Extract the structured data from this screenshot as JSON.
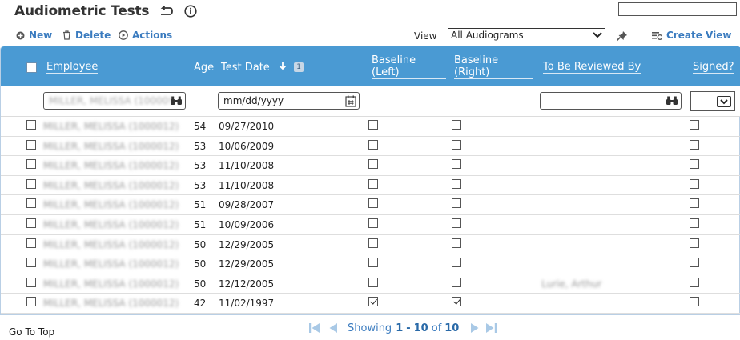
{
  "page": {
    "title": "Audiometric Tests",
    "icons": [
      "back-arrow-icon",
      "info-icon"
    ]
  },
  "toolbar": {
    "new_label": "New",
    "delete_label": "Delete",
    "actions_label": "Actions",
    "view_label": "View",
    "view_selected": "All Audiograms",
    "create_view_label": "Create View"
  },
  "columns": {
    "employee": "Employee",
    "age": "Age",
    "test_date": "Test Date",
    "sort_badge": "1",
    "baseline_left_1": "Baseline",
    "baseline_left_2": "(Left)",
    "baseline_right_1": "Baseline",
    "baseline_right_2": "(Right)",
    "reviewer": "To Be Reviewed By",
    "signed": "Signed?"
  },
  "filters": {
    "employee_value": "MILLER, MELISSA (10000!",
    "date_placeholder": "mm/dd/yyyy",
    "reviewer_value": ""
  },
  "rows": [
    {
      "employee": "MILLER, MELISSA (1000012)",
      "age": "54",
      "date": "09/27/2010",
      "bl": false,
      "br": false,
      "reviewer": "",
      "signed": false
    },
    {
      "employee": "MILLER, MELISSA (1000012)",
      "age": "53",
      "date": "10/06/2009",
      "bl": false,
      "br": false,
      "reviewer": "",
      "signed": false
    },
    {
      "employee": "MILLER, MELISSA (1000012)",
      "age": "53",
      "date": "11/10/2008",
      "bl": false,
      "br": false,
      "reviewer": "",
      "signed": false
    },
    {
      "employee": "MILLER, MELISSA (1000012)",
      "age": "53",
      "date": "11/10/2008",
      "bl": false,
      "br": false,
      "reviewer": "",
      "signed": false
    },
    {
      "employee": "MILLER, MELISSA (1000012)",
      "age": "51",
      "date": "09/28/2007",
      "bl": false,
      "br": false,
      "reviewer": "",
      "signed": false
    },
    {
      "employee": "MILLER, MELISSA (1000012)",
      "age": "51",
      "date": "10/09/2006",
      "bl": false,
      "br": false,
      "reviewer": "",
      "signed": false
    },
    {
      "employee": "MILLER, MELISSA (1000012)",
      "age": "50",
      "date": "12/29/2005",
      "bl": false,
      "br": false,
      "reviewer": "",
      "signed": false
    },
    {
      "employee": "MILLER, MELISSA (1000012)",
      "age": "50",
      "date": "12/29/2005",
      "bl": false,
      "br": false,
      "reviewer": "",
      "signed": false
    },
    {
      "employee": "MILLER, MELISSA (1000012)",
      "age": "50",
      "date": "12/12/2005",
      "bl": false,
      "br": false,
      "reviewer": "Lurie, Arthur",
      "signed": false
    },
    {
      "employee": "MILLER, MELISSA (1000012)",
      "age": "42",
      "date": "11/02/1997",
      "bl": true,
      "br": true,
      "reviewer": "",
      "signed": false
    }
  ],
  "footer": {
    "go_to_top": "Go To Top",
    "showing": "Showing",
    "range_start": "1",
    "dash": "-",
    "range_end": "10",
    "of": "of",
    "total": "10"
  },
  "colors": {
    "header_bg": "#4a9ad3",
    "link": "#3a7bbf"
  }
}
